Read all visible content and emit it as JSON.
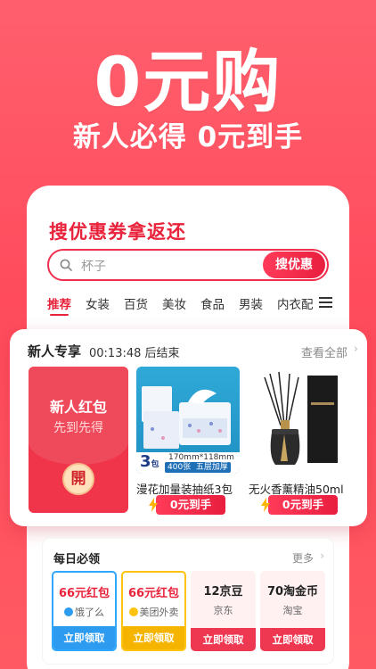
{
  "hero": {
    "title": "0元购",
    "subtitle": "新人必得 0元到手"
  },
  "search": {
    "title": "搜优惠券拿返还",
    "placeholder": "杯子",
    "button_label": "搜优惠"
  },
  "tabs": [
    "推荐",
    "女装",
    "百货",
    "美妆",
    "食品",
    "男装",
    "内衣配"
  ],
  "active_tab": "推荐",
  "new_user": {
    "title": "新人专享",
    "countdown": "00:13:48",
    "countdown_suffix": "后结束",
    "view_all": "查看全部",
    "red_packet": {
      "line1": "新人红包",
      "line2": "先到先得",
      "seal": "開"
    },
    "products": [
      {
        "name": "漫花加量装抽纸3包",
        "badge": "0元到手",
        "img_size_text": "170mm*118mm",
        "img_count": "3",
        "img_count_unit": "包",
        "img_tag": "400张  五层加厚"
      },
      {
        "name": "无火香薰精油50ml",
        "badge": "0元到手"
      }
    ]
  },
  "daily": {
    "title": "每日必领",
    "more": "更多",
    "coupons": [
      {
        "value": "66元红包",
        "source": "饿了么",
        "button": "立即领取",
        "color": "#2d9bf0"
      },
      {
        "value": "66元红包",
        "source": "美团外卖",
        "button": "立即领取",
        "color": "#f5b400"
      },
      {
        "value": "12京豆",
        "source": "京东",
        "button": "立即领取",
        "color": "#ee3750"
      },
      {
        "value": "70淘金币",
        "source": "淘宝",
        "button": "立即领取",
        "color": "#ee3750"
      }
    ]
  },
  "colors": {
    "brand_red": "#e8233b",
    "bg_gradient_top": "#ff5f6d"
  }
}
